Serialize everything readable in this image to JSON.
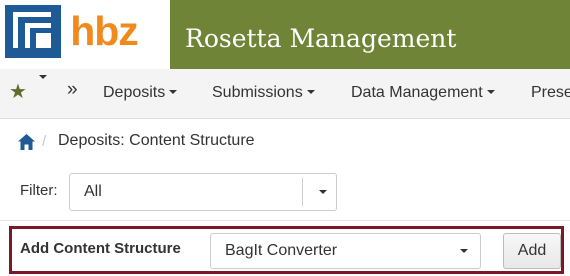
{
  "header": {
    "logo_text": "hbz",
    "title": "Rosetta Management"
  },
  "nav": {
    "favorites_icon": "star-icon",
    "more_icon": "double-chevron-right-icon",
    "items": [
      {
        "label": "Deposits"
      },
      {
        "label": "Submissions"
      },
      {
        "label": "Data Management"
      },
      {
        "label": "Prese"
      }
    ]
  },
  "breadcrumb": {
    "home_icon": "home-icon",
    "current": "Deposits: Content Structure"
  },
  "filter": {
    "label": "Filter:",
    "value": "All"
  },
  "add_content_structure": {
    "label": "Add Content Structure",
    "selected_type": "BagIt Converter",
    "add_button": "Add"
  },
  "colors": {
    "header_green": "#708437",
    "panel_border": "#7a1a26",
    "logo_orange": "#f08a1c",
    "logo_blue": "#1d5a96"
  }
}
